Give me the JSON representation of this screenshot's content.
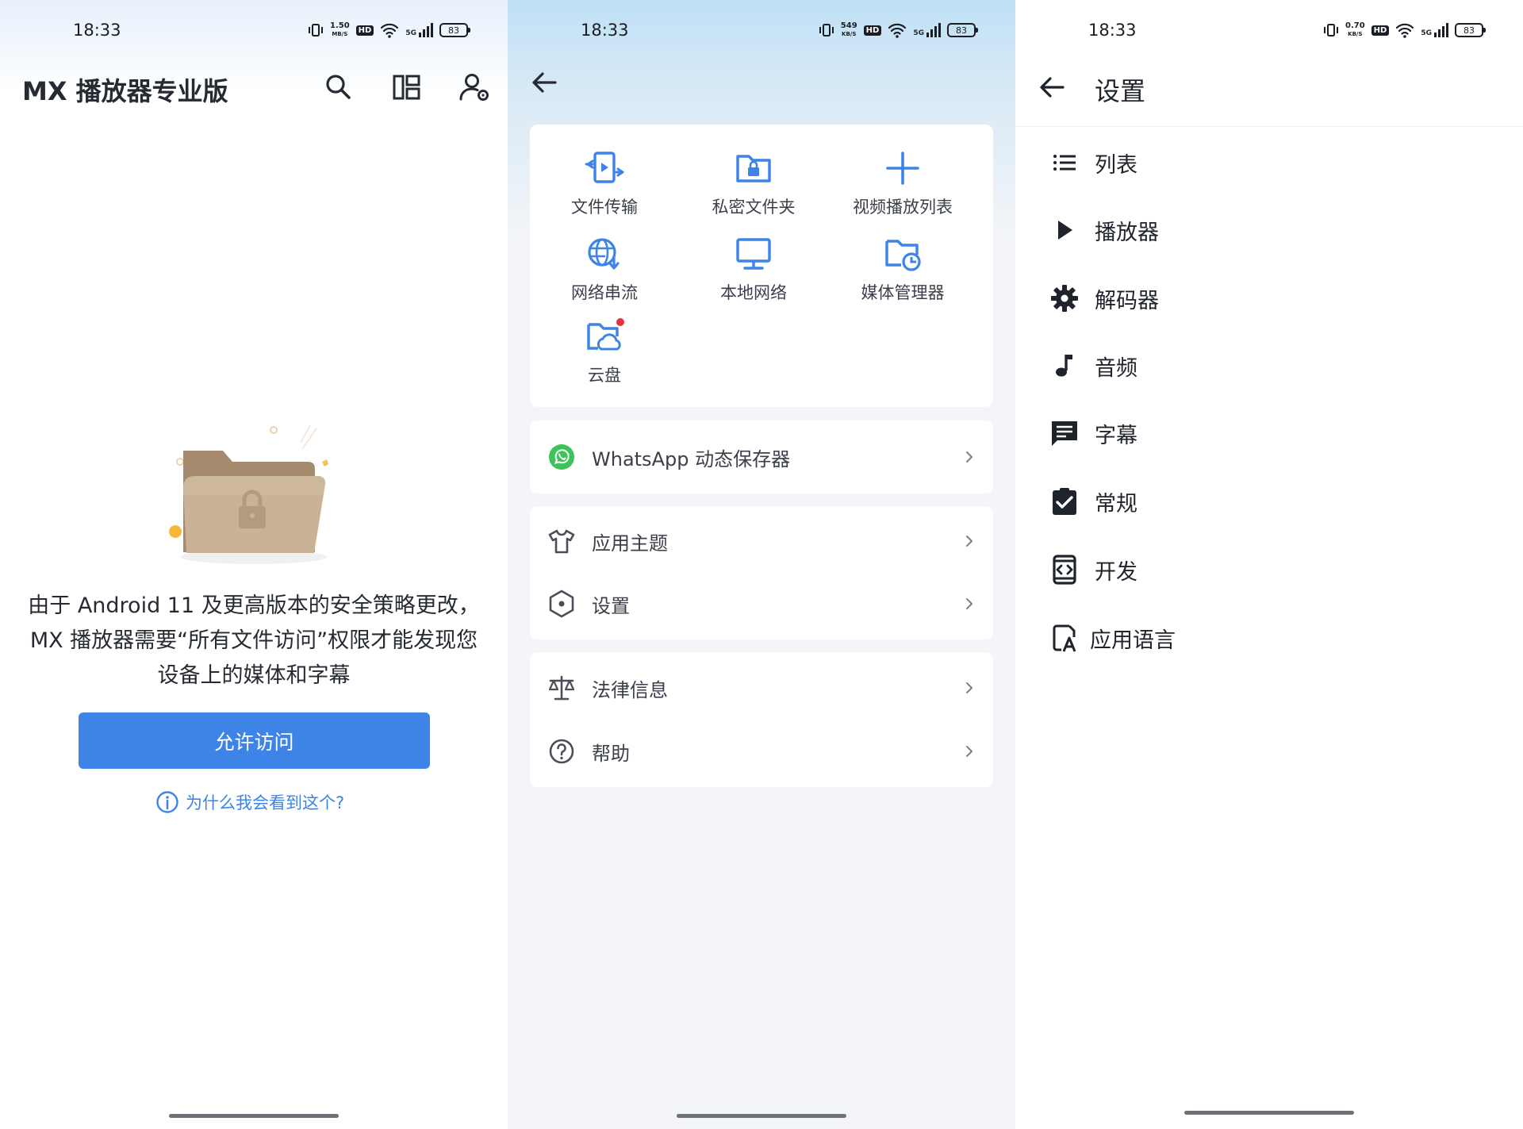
{
  "status_bars": [
    {
      "time": "18:33",
      "speed_top": "1.50",
      "speed_bottom": "MB/S",
      "hd": "HD",
      "net": "5G",
      "battery": "83"
    },
    {
      "time": "18:33",
      "speed_top": "549",
      "speed_bottom": "KB/S",
      "hd": "HD",
      "net": "5G",
      "battery": "83"
    },
    {
      "time": "18:33",
      "speed_top": "0.70",
      "speed_bottom": "KB/S",
      "hd": "HD",
      "net": "5G",
      "battery": "83"
    }
  ],
  "screen1": {
    "app_title": "MX 播放器专业版",
    "toolbar_icons": [
      "search-icon",
      "layout-icon",
      "account-settings-icon"
    ],
    "message": "由于 Android 11 及更高版本的安全策略更改，MX 播放器需要“所有文件访问”权限才能发现您设备上的媒体和字幕",
    "allow_button": "允许访问",
    "why_link": "为什么我会看到这个?"
  },
  "screen2": {
    "grid": [
      {
        "label": "文件传输",
        "icon": "file-transfer-icon"
      },
      {
        "label": "私密文件夹",
        "icon": "private-folder-icon"
      },
      {
        "label": "视频播放列表",
        "icon": "plus-icon"
      },
      {
        "label": "网络串流",
        "icon": "network-stream-icon"
      },
      {
        "label": "本地网络",
        "icon": "monitor-icon"
      },
      {
        "label": "媒体管理器",
        "icon": "media-manager-icon"
      },
      {
        "label": "云盘",
        "icon": "cloud-folder-icon"
      }
    ],
    "whatsapp": "WhatsApp 动态保存器",
    "group1": [
      "应用主题",
      "设置"
    ],
    "group2": [
      "法律信息",
      "帮助"
    ]
  },
  "screen3": {
    "title": "设置",
    "items": [
      {
        "label": "列表",
        "icon": "list-icon"
      },
      {
        "label": "播放器",
        "icon": "play-icon"
      },
      {
        "label": "解码器",
        "icon": "gear-icon"
      },
      {
        "label": "音频",
        "icon": "music-note-icon"
      },
      {
        "label": "字幕",
        "icon": "subtitle-icon"
      },
      {
        "label": "常规",
        "icon": "clipboard-check-icon"
      },
      {
        "label": "开发",
        "icon": "developer-icon"
      },
      {
        "label": "应用语言",
        "icon": "language-icon"
      }
    ]
  },
  "colors": {
    "accent": "#3d84e6",
    "text": "#262a33",
    "whatsapp": "#3ec35b",
    "dot": "#e8323c"
  }
}
